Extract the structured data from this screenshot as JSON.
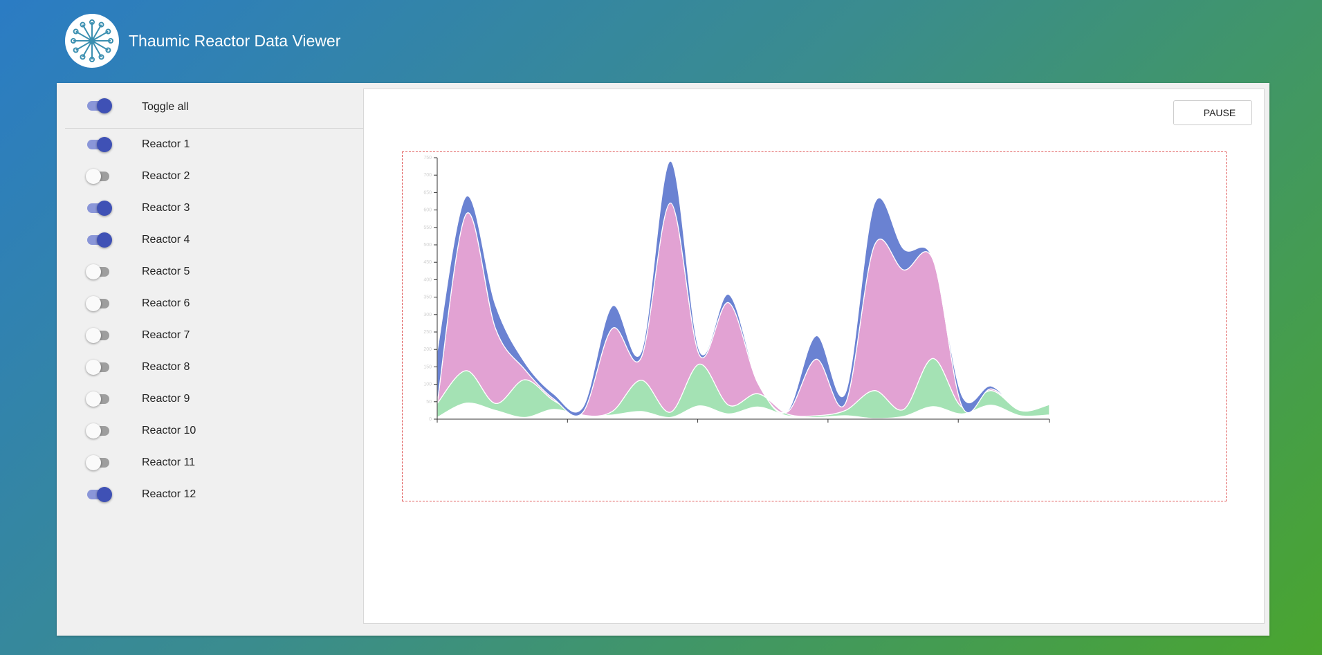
{
  "app": {
    "title": "Thaumic Reactor Data Viewer",
    "logo_icon": "dandelion-logo-icon"
  },
  "sidebar": {
    "toggle_all": {
      "label": "Toggle all",
      "on": true
    },
    "reactors": [
      {
        "label": "Reactor 1",
        "on": true,
        "color": "#a4e2b4"
      },
      {
        "label": "Reactor 2",
        "on": false
      },
      {
        "label": "Reactor 3",
        "on": true,
        "color": "#e2a2d3"
      },
      {
        "label": "Reactor 4",
        "on": true,
        "color": "#f3d8d1"
      },
      {
        "label": "Reactor 5",
        "on": false
      },
      {
        "label": "Reactor 6",
        "on": false
      },
      {
        "label": "Reactor 7",
        "on": false
      },
      {
        "label": "Reactor 8",
        "on": false
      },
      {
        "label": "Reactor 9",
        "on": false
      },
      {
        "label": "Reactor 10",
        "on": false
      },
      {
        "label": "Reactor 11",
        "on": false
      },
      {
        "label": "Reactor 12",
        "on": true,
        "color": "#6a82d2"
      }
    ]
  },
  "controls": {
    "pause_label": "PAUSE"
  },
  "chart_data": {
    "type": "area",
    "stacked": true,
    "curve": "smooth",
    "title": "",
    "xlabel": "",
    "ylabel": "",
    "ylim": [
      0,
      750
    ],
    "yticks": [
      0,
      50,
      100,
      150,
      200,
      250,
      300,
      350,
      400,
      450,
      500,
      550,
      600,
      650,
      700,
      750
    ],
    "x_points": 22,
    "x_tick_labels_illegible": true,
    "grid": false,
    "legend": "none",
    "series": [
      {
        "color": "#ffffff",
        "values": [
          5,
          46,
          25,
          5,
          28,
          10,
          12,
          22,
          5,
          38,
          15,
          35,
          10,
          5,
          10,
          2,
          8,
          36,
          15,
          40,
          10,
          12
        ]
      },
      {
        "color": "#a4e2b4",
        "values": [
          40,
          93,
          20,
          108,
          25,
          2,
          10,
          90,
          15,
          120,
          25,
          38,
          5,
          5,
          15,
          80,
          20,
          138,
          20,
          42,
          15,
          30
        ]
      },
      {
        "color": "#e2a2d3",
        "values": [
          0,
          450,
          215,
          30,
          5,
          8,
          238,
          65,
          600,
          25,
          294,
          30,
          5,
          162,
          20,
          417,
          400,
          285,
          2,
          5
        ]
      },
      {
        "color": "#6a82d2",
        "values": [
          150,
          50,
          67,
          20,
          14,
          15,
          64,
          16,
          120,
          12,
          24,
          5,
          2,
          67,
          30,
          120,
          60,
          2,
          30,
          8
        ]
      }
    ]
  }
}
